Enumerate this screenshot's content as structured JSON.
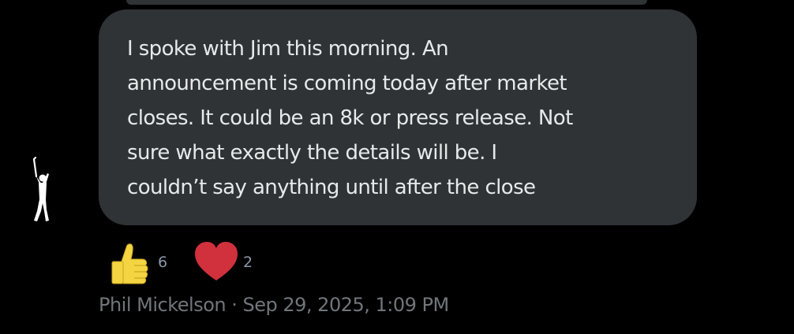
{
  "message": {
    "lines": [
      "I spoke with Jim this morning. An",
      "announcement is coming today after market",
      "closes. It could be an 8k or press release. Not",
      "sure what exactly the details will be. I",
      "couldn’t say anything until after the close"
    ]
  },
  "reactions": [
    {
      "icon": "thumbs-up-icon",
      "count": "6",
      "color": "#f4d03f"
    },
    {
      "icon": "heart-icon",
      "count": "2",
      "color": "#d0313d"
    }
  ],
  "meta": {
    "sender": "Phil Mickelson",
    "separator": "·",
    "timestamp": "Sep 29, 2025, 1:09 PM"
  },
  "colors": {
    "background": "#000000",
    "bubble": "#2f3336",
    "text": "#e7e9ea",
    "meta": "#71767b"
  }
}
